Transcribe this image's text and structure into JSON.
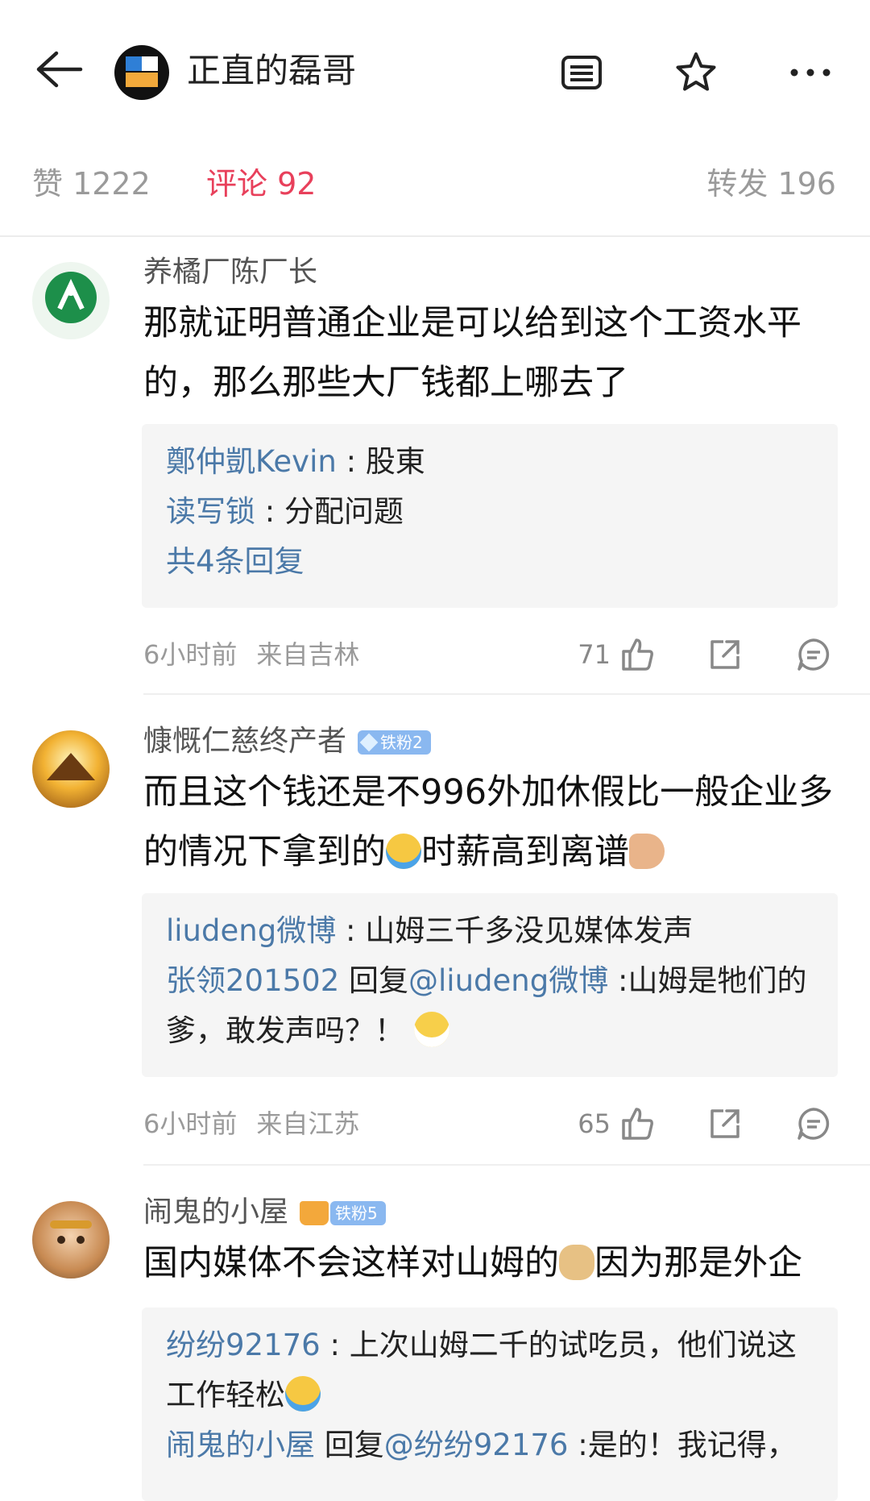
{
  "header": {
    "author_name": "正直的磊哥",
    "icons": [
      "back-arrow-icon",
      "author-logo",
      "list-icon",
      "star-icon",
      "more-icon"
    ]
  },
  "tabs": {
    "likes": "赞 1222",
    "comments": "评论 92",
    "reposts": "转发 196",
    "active_color": "#e8405b"
  },
  "comments": [
    {
      "user": "养橘厂陈厂长",
      "text": "那就证明普通企业是可以给到这个工资水平的，那么那些大厂钱都上哪去了",
      "replies": [
        {
          "user": "鄭仲凱Kevin",
          "sep": " : ",
          "text": "股東"
        },
        {
          "user": "读写锁",
          "sep": " : ",
          "text": "分配问题"
        }
      ],
      "more": "共4条回复",
      "time": "6小时前",
      "location": "来自吉林",
      "likes": "71"
    },
    {
      "user": "慷慨仁慈终产者",
      "badge": "铁粉2",
      "text1": "而且这个钱还是不996外加休假比一般企业多的情况下拿到的",
      "text2": "时薪高到离谱",
      "reply1": {
        "user": "liudeng微博",
        "sep": " : ",
        "text": "山姆三千多没见媒体发声"
      },
      "reply2": {
        "user": "张领201502",
        "mid": " 回复",
        "mention": "@liudeng微博",
        "text": " :山姆是牠们的爹，敢发声吗？！"
      },
      "time": "6小时前",
      "location": "来自江苏",
      "likes": "65"
    },
    {
      "user": "闹鬼的小屋",
      "badge": "铁粉5",
      "text1": "国内媒体不会这样对山姆的",
      "text2": "因为那是外企",
      "reply1": {
        "user": "纷纷92176",
        "sep": " : ",
        "text": "上次山姆二千的试吃员，他们说这工作轻松"
      },
      "reply2": {
        "user": "闹鬼的小屋",
        "mid": " 回复",
        "mention": "@纷纷92176",
        "text": " :是的！我记得，"
      }
    }
  ],
  "colors": {
    "link": "#4b79a8",
    "meta": "#9a9a9a",
    "reply_bg": "#f5f5f5"
  }
}
